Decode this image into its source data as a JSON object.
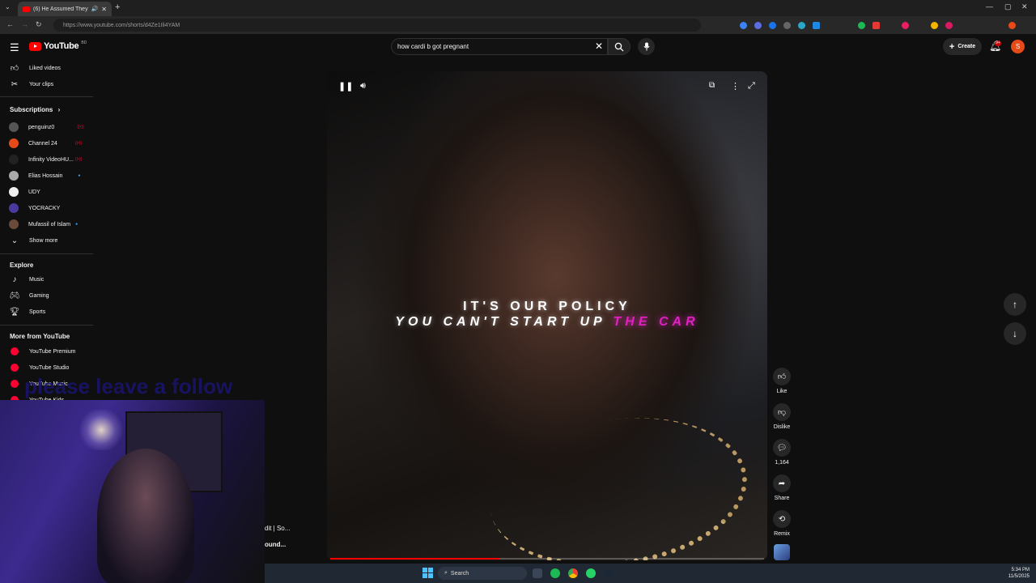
{
  "browser": {
    "tab_title": "(6) He Assumed They Were...",
    "url": "https://www.youtube.com/shorts/d4Ze1Ili4YAM"
  },
  "header": {
    "logo_text": "YouTube",
    "country_code": "BD",
    "search_query": "how cardi b got pregnant",
    "create_label": "Create",
    "notification_count": "9+",
    "avatar_letter": "S"
  },
  "sidebar": {
    "top_items": [
      {
        "label": "Liked videos",
        "icon": "thumb-up-icon"
      },
      {
        "label": "Your clips",
        "icon": "scissors-icon"
      }
    ],
    "subscriptions_heading": "Subscriptions",
    "subscriptions": [
      {
        "label": "penguinz0",
        "avatar_color": "#555555",
        "status": "live"
      },
      {
        "label": "Channel 24",
        "avatar_color": "#e64a19",
        "status": "live"
      },
      {
        "label": "Infinity VideoHU...",
        "avatar_color": "#222222",
        "status": "live"
      },
      {
        "label": "Elias Hossain",
        "avatar_color": "#aaaaaa",
        "status": "new"
      },
      {
        "label": "UDY",
        "avatar_color": "#eeeeee",
        "status": ""
      },
      {
        "label": "YOCRACKY",
        "avatar_color": "#4a3aa0",
        "status": ""
      },
      {
        "label": "Mufassil of Islam",
        "avatar_color": "#6a4a3a",
        "status": "new"
      }
    ],
    "show_more": "Show more",
    "explore_heading": "Explore",
    "explore": [
      {
        "label": "Music",
        "icon": "music-note-icon"
      },
      {
        "label": "Gaming",
        "icon": "gamepad-icon"
      },
      {
        "label": "Sports",
        "icon": "trophy-icon"
      }
    ],
    "more_heading": "More from YouTube",
    "more": [
      {
        "label": "YouTube Premium"
      },
      {
        "label": "YouTube Studio"
      },
      {
        "label": "YouTube Music"
      },
      {
        "label": "YouTube Kids"
      }
    ]
  },
  "overlay": {
    "follow_text": "please leave a follow",
    "cut_line_1": "dit | So...",
    "cut_line_2": "ound..."
  },
  "video": {
    "caption_line1": "IT'S OUR POLICY",
    "caption_line2_white": "YOU CAN'T START UP ",
    "caption_line2_pink": "THE CAR",
    "progress_fraction": 0.39
  },
  "actions": {
    "like": "Like",
    "dislike": "Dislike",
    "comments": "1,164",
    "share": "Share",
    "remix": "Remix"
  },
  "taskbar": {
    "search_label": "Search",
    "time": "5:34 PM",
    "date": "11/5/2025"
  }
}
